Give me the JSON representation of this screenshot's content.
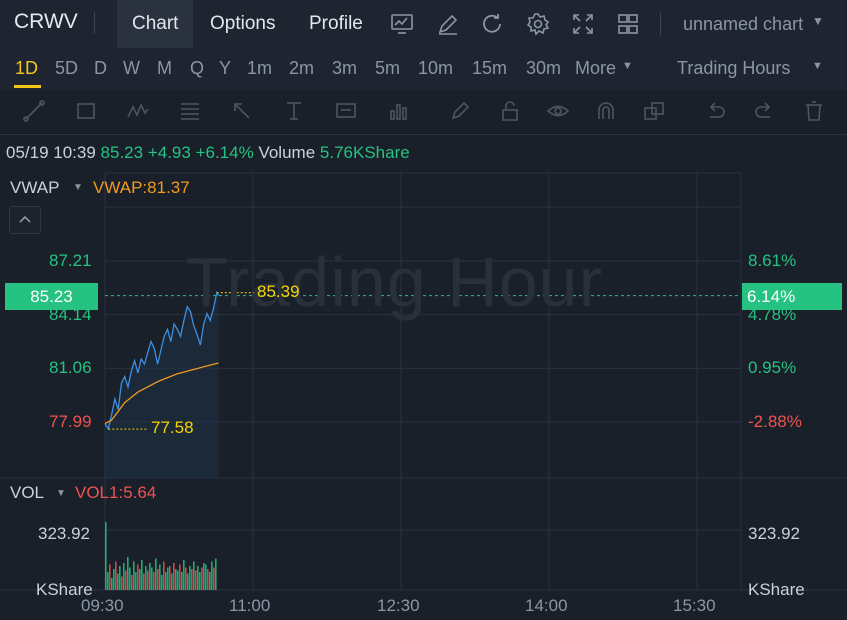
{
  "header": {
    "ticker": "CRWV",
    "tabs": [
      {
        "label": "Chart",
        "active": true
      },
      {
        "label": "Options",
        "active": false
      },
      {
        "label": "Profile",
        "active": false
      }
    ],
    "icons": [
      "indicator-chart-icon",
      "draw-pen-icon",
      "refresh-icon",
      "settings-gear-icon",
      "fullscreen-icon",
      "layout-grid-icon"
    ],
    "chart_name": "unnamed chart"
  },
  "periods": {
    "items": [
      "1D",
      "5D",
      "D",
      "W",
      "M",
      "Q",
      "Y",
      "1m",
      "2m",
      "3m",
      "5m",
      "10m",
      "15m",
      "30m"
    ],
    "active": "1D",
    "more_label": "More",
    "session_label": "Trading Hours"
  },
  "drawing_toolbar": {
    "icons": [
      "trend-line-icon",
      "rectangle-icon",
      "pattern-icon",
      "fibonacci-icon",
      "arrow-icon",
      "text-icon",
      "annotation-icon",
      "measure-icon",
      "pencil-icon",
      "lock-icon",
      "eye-icon",
      "magnet-icon",
      "layers-icon",
      "undo-icon",
      "redo-icon",
      "trash-icon"
    ]
  },
  "info": {
    "datetime": "05/19 10:39",
    "price": "85.23",
    "change": "+4.93",
    "change_pct": "+6.14%",
    "volume_label": "Volume",
    "volume_value": "5.76KShare"
  },
  "indicator": {
    "name": "VWAP",
    "value_text": "VWAP:81.37"
  },
  "watermark": "Trading Hour",
  "colors": {
    "up": "#26c281",
    "down": "#f0524f",
    "price_line": "#3b8fe0",
    "vwap_line": "#f29a1f",
    "marker_label": "#f5d400",
    "active_period": "#f5c518"
  },
  "volume_pane": {
    "name": "VOL",
    "value_text": "VOL1:5.64",
    "max_label": "323.92",
    "unit_label": "KShare"
  },
  "chart_data": {
    "type": "line",
    "x_ticks": [
      "09:30",
      "11:00",
      "12:30",
      "14:00",
      "15:30"
    ],
    "price_ticks": [
      {
        "value": 87.21,
        "label": "87.21",
        "pct": "8.61%",
        "dir": "up"
      },
      {
        "value": 84.14,
        "label": "84.14",
        "pct": "4.78%",
        "dir": "up"
      },
      {
        "value": 81.06,
        "label": "81.06",
        "pct": "0.95%",
        "dir": "up"
      },
      {
        "value": 77.99,
        "label": "77.99",
        "pct": "-2.88%",
        "dir": "down"
      }
    ],
    "current_price": {
      "value": 85.23,
      "label": "85.23",
      "pct": "6.14%"
    },
    "high_marker": {
      "value": 85.39,
      "label": "85.39"
    },
    "low_marker": {
      "value": 77.58,
      "label": "77.58"
    },
    "series": [
      {
        "name": "Price",
        "x": [
          "09:30",
          "09:32",
          "09:34",
          "09:36",
          "09:38",
          "09:40",
          "09:42",
          "09:44",
          "09:46",
          "09:48",
          "09:50",
          "09:52",
          "09:54",
          "09:56",
          "09:58",
          "10:00",
          "10:02",
          "10:04",
          "10:06",
          "10:08",
          "10:10",
          "10:12",
          "10:14",
          "10:16",
          "10:18",
          "10:20",
          "10:22",
          "10:24",
          "10:26",
          "10:28",
          "10:30",
          "10:32",
          "10:34",
          "10:36",
          "10:38",
          "10:39"
        ],
        "values": [
          77.9,
          77.6,
          78.4,
          79.3,
          78.7,
          80.2,
          80.6,
          80.0,
          80.9,
          81.5,
          80.8,
          81.6,
          81.3,
          82.0,
          82.6,
          82.2,
          81.3,
          82.1,
          82.9,
          83.3,
          82.6,
          83.6,
          83.3,
          82.9,
          83.8,
          84.6,
          84.3,
          83.5,
          83.0,
          82.4,
          83.6,
          84.2,
          83.8,
          84.5,
          85.39,
          85.23
        ]
      },
      {
        "name": "VWAP",
        "x": [
          "09:30",
          "09:34",
          "09:38",
          "09:42",
          "09:46",
          "09:50",
          "09:54",
          "09:58",
          "10:02",
          "10:06",
          "10:10",
          "10:14",
          "10:18",
          "10:22",
          "10:26",
          "10:30",
          "10:34",
          "10:39"
        ],
        "values": [
          77.9,
          78.1,
          78.6,
          79.1,
          79.4,
          79.7,
          79.9,
          80.1,
          80.3,
          80.45,
          80.6,
          80.75,
          80.85,
          80.95,
          81.05,
          81.15,
          81.25,
          81.37
        ]
      }
    ],
    "volume": {
      "unit": "KShare",
      "max": 323.92,
      "values": [
        323.92,
        60,
        85,
        40,
        70,
        95,
        55,
        80,
        45,
        90,
        65,
        110,
        75,
        50,
        95,
        60,
        85,
        70,
        100,
        55,
        80,
        65,
        90,
        75,
        60,
        105,
        70,
        85,
        50,
        95,
        60,
        75,
        80,
        55,
        90,
        70,
        65,
        85,
        60,
        100,
        75,
        55,
        80,
        70,
        95,
        65,
        80,
        60,
        75,
        90,
        85,
        70,
        60,
        95,
        75,
        105
      ],
      "up": [
        true,
        true,
        false,
        true,
        true,
        false,
        true,
        true,
        false,
        true,
        false,
        true,
        true,
        false,
        true,
        true,
        false,
        true,
        true,
        false,
        true,
        false,
        true,
        true,
        false,
        true,
        false,
        true,
        true,
        false,
        true,
        true,
        false,
        true,
        false,
        true,
        true,
        false,
        true,
        true,
        false,
        true,
        true,
        false,
        true,
        false,
        true,
        true,
        false,
        true,
        true,
        false,
        true,
        true,
        false,
        true
      ]
    },
    "grid": true
  }
}
